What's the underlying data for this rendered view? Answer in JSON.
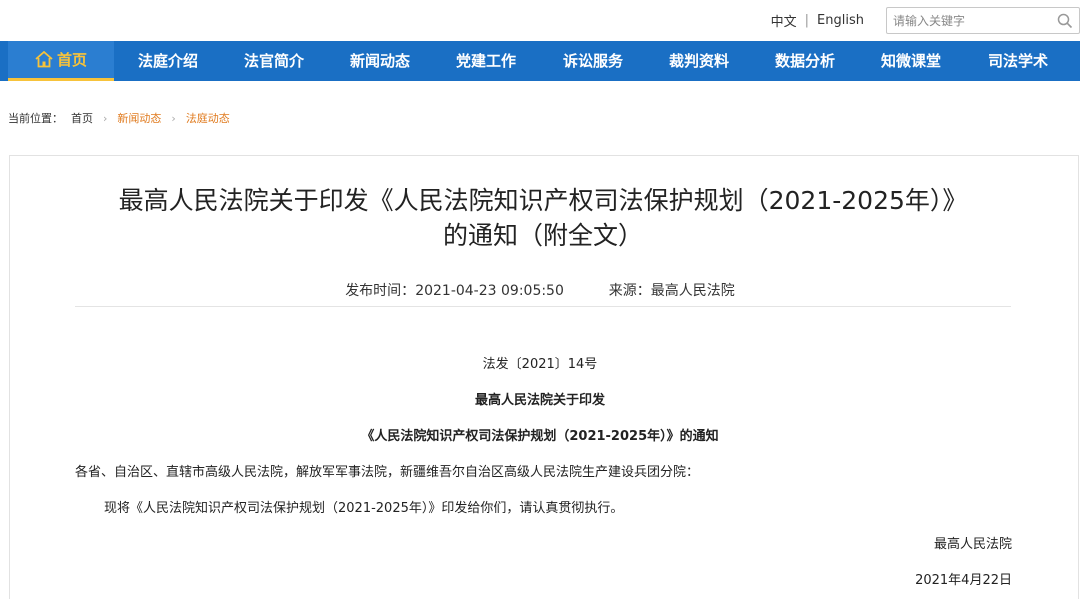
{
  "header": {
    "lang_cn": "中文",
    "lang_separator": "|",
    "lang_en": "English",
    "search_placeholder": "请输入关键字"
  },
  "nav": {
    "home": "首页",
    "items": [
      "法庭介绍",
      "法官简介",
      "新闻动态",
      "党建工作",
      "诉讼服务",
      "裁判资料",
      "数据分析",
      "知微课堂",
      "司法学术"
    ]
  },
  "breadcrumb": {
    "label": "当前位置：",
    "items": [
      "首页",
      "新闻动态",
      "法庭动态"
    ]
  },
  "article": {
    "title_line1": "最高人民法院关于印发《人民法院知识产权司法保护规划（2021-2025年）》",
    "title_line2": "的通知（附全文）",
    "publish_label": "发布时间：",
    "publish_time": "2021-04-23 09:05:50",
    "source_label": "来源：",
    "source": "最高人民法院",
    "doc_number": "法发〔2021〕14号",
    "heading1": "最高人民法院关于印发",
    "heading2": "《人民法院知识产权司法保护规划（2021-2025年）》的通知",
    "recipients": "各省、自治区、直辖市高级人民法院，解放军军事法院，新疆维吾尔自治区高级人民法院生产建设兵团分院：",
    "body": "现将《人民法院知识产权司法保护规划（2021-2025年）》印发给你们，请认真贯彻执行。",
    "signature": "最高人民法院",
    "date": "2021年4月22日"
  },
  "colors": {
    "nav_bg": "#1a6fc4",
    "nav_active": "#f7c33b",
    "crumb_link": "#e07b1f"
  }
}
